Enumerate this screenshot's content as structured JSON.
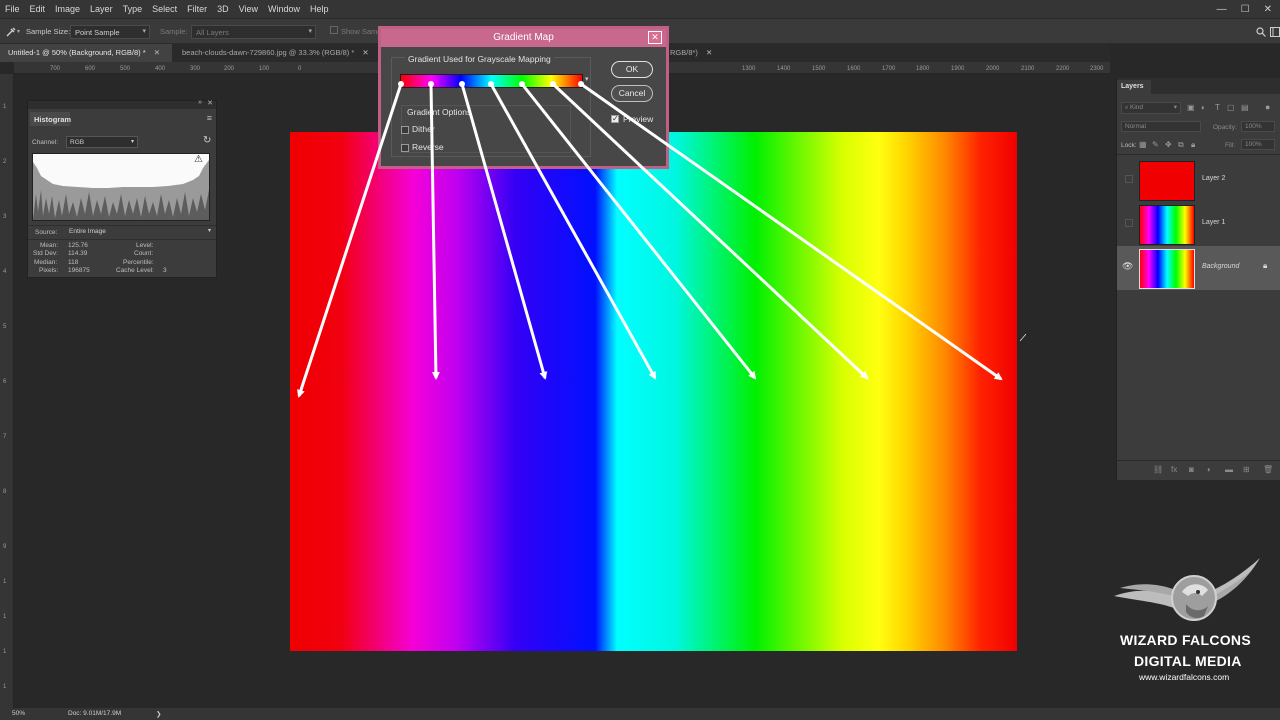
{
  "menu": [
    "File",
    "Edit",
    "Image",
    "Layer",
    "Type",
    "Select",
    "Filter",
    "3D",
    "View",
    "Window",
    "Help"
  ],
  "window_controls": [
    "—",
    "☐",
    "✕"
  ],
  "options": {
    "sample_size_label": "Sample Size:",
    "sample_size_value": "Point Sample",
    "sample_label": "Sample:",
    "sample_value": "All Layers",
    "show_sampling": "Show Sampl"
  },
  "tabs": [
    {
      "label": "Untitled-1 @ 50% (Background, RGB/8) *",
      "close": "✕"
    },
    {
      "label": "beach-clouds-dawn-729860.jpg @ 33.3% (RGB/8) *",
      "close": "✕"
    },
    {
      "label": "RGB/8*)",
      "close": "✕"
    }
  ],
  "ruler_top": [
    "700",
    "600",
    "500",
    "400",
    "300",
    "200",
    "100",
    "0",
    "1300",
    "1400",
    "1500",
    "1600",
    "1700",
    "1800",
    "1900",
    "2000",
    "2100",
    "2200",
    "2300"
  ],
  "ruler_left": [
    "1",
    "2",
    "3",
    "4",
    "5",
    "6",
    "7",
    "8",
    "9",
    "1",
    "1",
    "1",
    "1"
  ],
  "histogram": {
    "title": "Histogram",
    "channel_label": "Channel:",
    "channel_value": "RGB",
    "source_label": "Source:",
    "source_value": "Entire Image",
    "stats": {
      "mean_label": "Mean:",
      "mean": "125.76",
      "std_label": "Std Dev:",
      "std": "114.39",
      "median_label": "Median:",
      "median": "118",
      "pixels_label": "Pixels:",
      "pixels": "196875",
      "level_label": "Level:",
      "count_label": "Count:",
      "percentile_label": "Percentile:",
      "cache_label": "Cache Level:",
      "cache": "3"
    }
  },
  "dialog": {
    "title": "Gradient Map",
    "close": "✕",
    "group_label": "Gradient Used for Grayscale Mapping",
    "options_label": "Gradient Options",
    "dither": "Dither",
    "reverse": "Reverse",
    "ok": "OK",
    "cancel": "Cancel",
    "preview": "Preview"
  },
  "layers": {
    "title": "Layers",
    "kind": "Kind",
    "blend": "Normal",
    "opacity_label": "Opacity:",
    "opacity": "100%",
    "lock_label": "Lock:",
    "fill_label": "Fill:",
    "fill": "100%",
    "items": [
      {
        "name": "Layer 2"
      },
      {
        "name": "Layer 1"
      },
      {
        "name": "Background"
      }
    ]
  },
  "watermark": {
    "line1": "WIZARD FALCONS",
    "line2": "DIGITAL MEDIA",
    "url": "www.wizardfalcons.com"
  },
  "status": {
    "zoom": "50%",
    "doc": "Doc: 9.01M/17.9M",
    "arrow": "❯"
  },
  "colors": {
    "dialog_title": "#c8688c",
    "canvas_red": "#f00000"
  }
}
